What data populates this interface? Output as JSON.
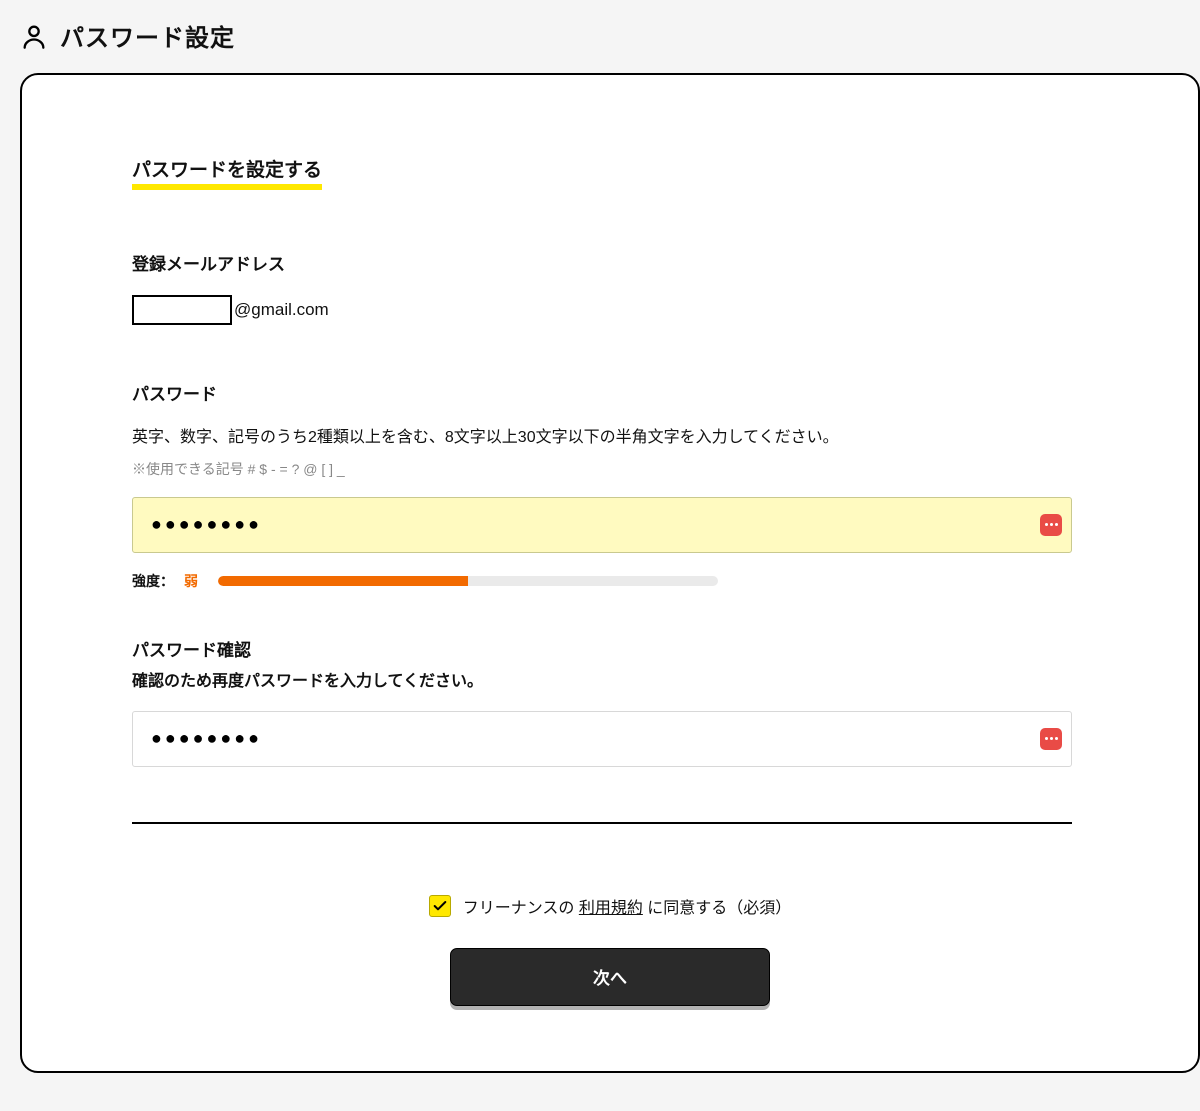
{
  "header": {
    "title": "パスワード設定"
  },
  "form": {
    "section_title": "パスワードを設定する",
    "email": {
      "label": "登録メールアドレス",
      "domain": "@gmail.com"
    },
    "password": {
      "label": "パスワード",
      "desc": "英字、数字、記号のうち2種類以上を含む、8文字以上30文字以下の半角文字を入力してください。",
      "note": "※使用できる記号 # $ - = ? @ [ ] _",
      "value": "●●●●●●●●",
      "strength": {
        "label": "強度：",
        "value": "弱",
        "percent": 50
      }
    },
    "confirm": {
      "label": "パスワード確認",
      "desc": "確認のため再度パスワードを入力してください。",
      "value": "●●●●●●●●"
    },
    "agreement": {
      "prefix": "フリーナンスの ",
      "link": "利用規約",
      "suffix": " に同意する（必須）",
      "checked": true
    },
    "next_label": "次へ"
  }
}
